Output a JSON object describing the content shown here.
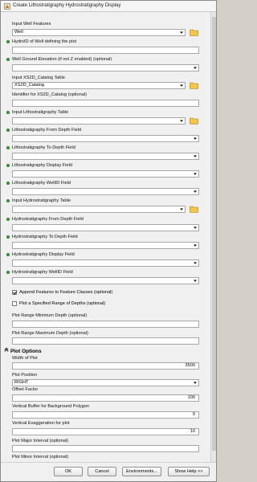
{
  "window": {
    "title": "Create Lithostratigraphy Hydrostratigraphy Display"
  },
  "fields": {
    "input_well_features": {
      "label": "Input Well Features",
      "value": "Well"
    },
    "hydroid_well": {
      "label": "HydroID of Well defining the plot",
      "value": ""
    },
    "well_ground_elevation": {
      "label": "Well Ground Elevation (if not Z enabled) (optional)",
      "value": ""
    },
    "input_xs2d_catalog": {
      "label": "Input XS2D_Catalog Table",
      "value": "XS2D_Catalog"
    },
    "identifier_xs2d": {
      "label": "Identifier for XS2D_Catalog (optional)",
      "value": ""
    },
    "input_litho_table": {
      "label": "Input Lithostratigraphy Table",
      "value": ""
    },
    "litho_from_depth": {
      "label": "Lithostratigraphy From Depth Field",
      "value": ""
    },
    "litho_to_depth": {
      "label": "Lithostratigraphy To Depth Field",
      "value": ""
    },
    "litho_display": {
      "label": "Lithostratigraphy Display Field",
      "value": ""
    },
    "litho_wellid": {
      "label": "Lithostratigraphy WellID Field",
      "value": ""
    },
    "input_hydro_table": {
      "label": "Input Hydrostratigraphy Table",
      "value": ""
    },
    "hydro_from_depth": {
      "label": "Hydrostratigraphy From Depth Field",
      "value": ""
    },
    "hydro_to_depth": {
      "label": "Hydrostratigraphy To Depth Field",
      "value": ""
    },
    "hydro_display": {
      "label": "Hydrostratigraphy Display Field",
      "value": ""
    },
    "hydro_wellid": {
      "label": "Hydrostratigraphy WellID Field",
      "value": ""
    },
    "append_features": {
      "label": "Append Features to Feature Classes (optional)",
      "checked": true
    },
    "plot_specified_range": {
      "label": "Plot a Specified Range of Depths (optional)",
      "checked": false
    },
    "plot_range_min": {
      "label": "Plot Range Minimum Depth (optional)",
      "value": ""
    },
    "plot_range_max": {
      "label": "Plot Range Maximum Depth (optional)",
      "value": ""
    }
  },
  "plot_options": {
    "section_label": "Plot Options",
    "width_of_plot": {
      "label": "Width of Plot",
      "value": "3500"
    },
    "plot_position": {
      "label": "Plot Position",
      "value": "RIGHT"
    },
    "offset_factor": {
      "label": "Offset Factor",
      "value": "100"
    },
    "vertical_buffer": {
      "label": "Vertical Buffer for Background Polygon",
      "value": "0"
    },
    "vertical_exaggeration": {
      "label": "Vertical Exaggeration for plot",
      "value": "10"
    },
    "plot_major_interval": {
      "label": "Plot Major Interval (optional)",
      "value": ""
    },
    "plot_minor_interval": {
      "label": "Plot Minor Interval (optional)",
      "value": ""
    }
  },
  "buttons": {
    "ok": "OK",
    "cancel": "Cancel",
    "environments": "Environments...",
    "show_help": "Show Help >>"
  },
  "colors": {
    "required_dot": "#3cac3c",
    "window_bg": "#f0f0f0"
  }
}
